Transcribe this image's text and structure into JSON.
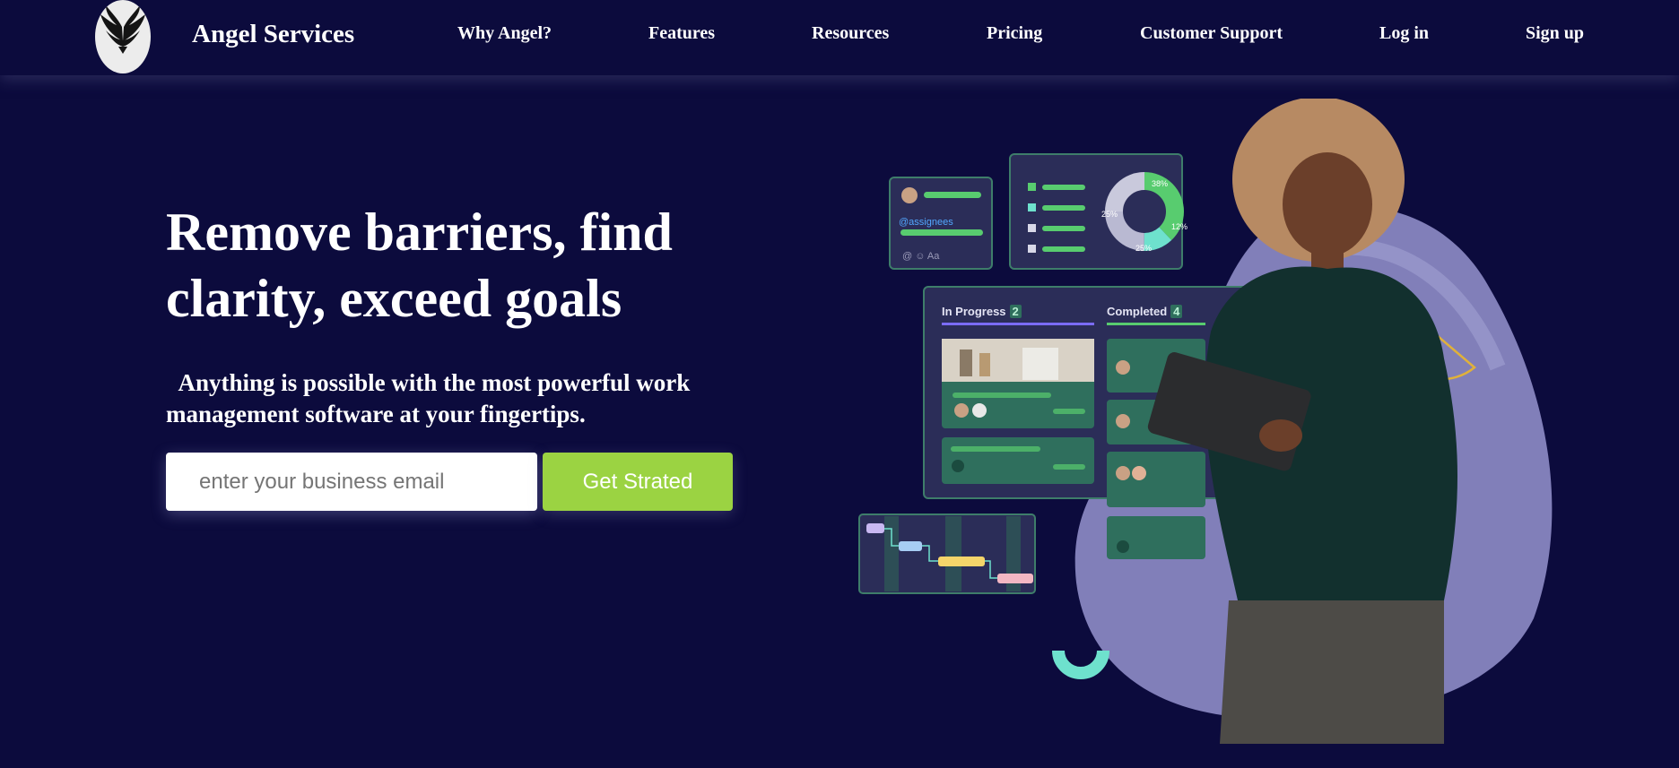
{
  "brand": {
    "name": "Angel Services",
    "logo_icon": "angel-wings-icon"
  },
  "nav": {
    "links": [
      {
        "label": "Why Angel?"
      },
      {
        "label": "Features"
      },
      {
        "label": "Resources"
      },
      {
        "label": "Pricing"
      },
      {
        "label": "Customer Support"
      },
      {
        "label": "Log in"
      },
      {
        "label": "Sign up"
      }
    ]
  },
  "hero": {
    "headline": "Remove barriers, find clarity, exceed goals",
    "subheadline": "Anything is possible with the most powerful work management software at your fingertips.",
    "email_placeholder": "enter your business email",
    "cta_label": "Get Strated"
  },
  "illustration": {
    "assignees_tag": "@assignees",
    "pie_labels": [
      "38%",
      "12%",
      "25%",
      "25%"
    ],
    "board": [
      {
        "label": "In Progress",
        "count": "2"
      },
      {
        "label": "Completed",
        "count": "4"
      }
    ],
    "format_icons": "@ ☺ Aa"
  },
  "colors": {
    "background": "#0c0b3d",
    "accent_green": "#9bd342",
    "card_dark": "#2b2d58",
    "card_green": "#2f6f5d",
    "bar_green": "#58cc6f",
    "progress_purple": "#7b6cf6",
    "blob_lilac": "#8e8cc6"
  }
}
